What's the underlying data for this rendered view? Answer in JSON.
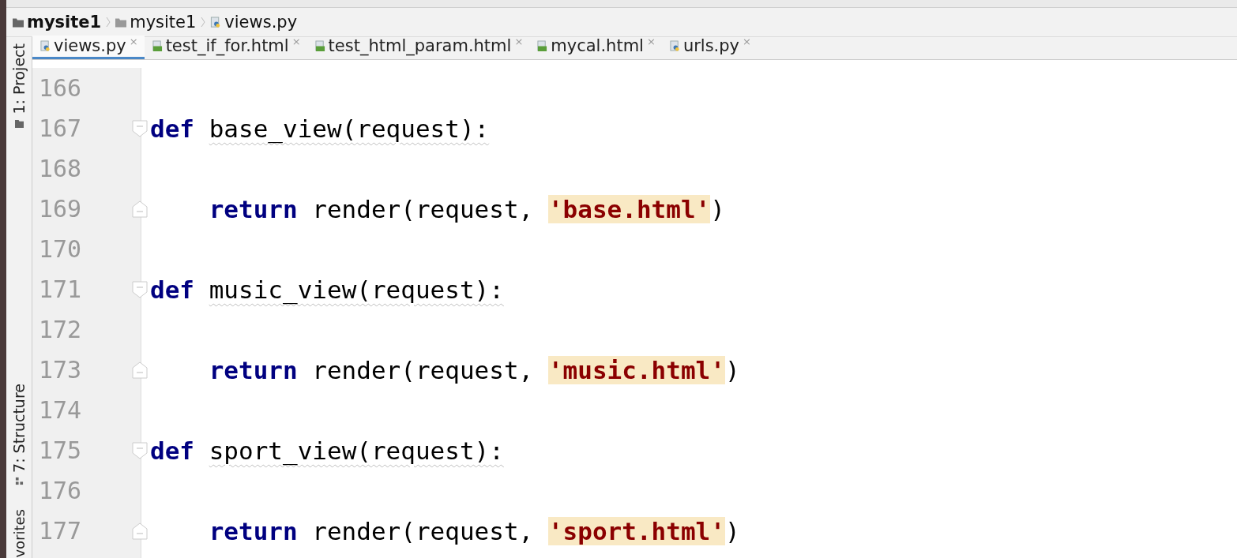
{
  "breadcrumbs": [
    {
      "label": "mysite1",
      "kind": "project"
    },
    {
      "label": "mysite1",
      "kind": "folder"
    },
    {
      "label": "views.py",
      "kind": "python"
    }
  ],
  "side_tabs": [
    {
      "label": "1: Project",
      "kind": "folder"
    },
    {
      "label": "7: Structure",
      "kind": "structure"
    },
    {
      "label": "vorites",
      "kind": "none"
    }
  ],
  "tabs": [
    {
      "label": "views.py",
      "kind": "python",
      "selected": true,
      "close": "×"
    },
    {
      "label": "test_if_for.html",
      "kind": "html",
      "selected": false,
      "close": "×"
    },
    {
      "label": "test_html_param.html",
      "kind": "html",
      "selected": false,
      "close": "×"
    },
    {
      "label": "mycal.html",
      "kind": "html",
      "selected": false,
      "close": "×"
    },
    {
      "label": "urls.py",
      "kind": "python",
      "selected": false,
      "close": "×"
    }
  ],
  "editor": {
    "lines": [
      {
        "number": "166",
        "kind": "blank"
      },
      {
        "number": "167",
        "kind": "def",
        "tokens": [
          {
            "kind": "keyword",
            "text": "def"
          },
          {
            "kind": "warn",
            "text": "base_view(request):"
          }
        ]
      },
      {
        "number": "168",
        "kind": "blank"
      },
      {
        "number": "169",
        "kind": "return",
        "tokens": [
          {
            "kind": "keyword",
            "text": "return"
          },
          {
            "kind": "plain",
            "text": "render(request,"
          },
          {
            "kind": "string",
            "text": "'base.html'"
          },
          {
            "kind": "plain",
            "text": ")"
          }
        ]
      },
      {
        "number": "170",
        "kind": "blank"
      },
      {
        "number": "171",
        "kind": "def",
        "tokens": [
          {
            "kind": "keyword",
            "text": "def"
          },
          {
            "kind": "warn",
            "text": "music_view(request):"
          }
        ]
      },
      {
        "number": "172",
        "kind": "blank"
      },
      {
        "number": "173",
        "kind": "return",
        "tokens": [
          {
            "kind": "keyword",
            "text": "return"
          },
          {
            "kind": "plain",
            "text": "render(request,"
          },
          {
            "kind": "string",
            "text": "'music.html'"
          },
          {
            "kind": "plain",
            "text": ")"
          }
        ]
      },
      {
        "number": "174",
        "kind": "blank"
      },
      {
        "number": "175",
        "kind": "def",
        "tokens": [
          {
            "kind": "keyword",
            "text": "def"
          },
          {
            "kind": "warn",
            "text": "sport_view(request):"
          }
        ]
      },
      {
        "number": "176",
        "kind": "blank"
      },
      {
        "number": "177",
        "kind": "return",
        "tokens": [
          {
            "kind": "keyword",
            "text": "return"
          },
          {
            "kind": "plain",
            "text": "render(request,"
          },
          {
            "kind": "string",
            "text": "'sport.html'"
          },
          {
            "kind": "plain",
            "text": ")"
          }
        ]
      }
    ]
  }
}
